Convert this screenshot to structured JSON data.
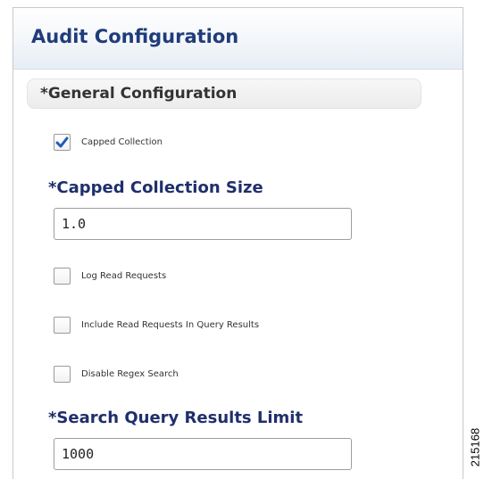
{
  "panel": {
    "title": "Audit Configuration"
  },
  "section": {
    "title": "*General Configuration"
  },
  "checkboxes": [
    {
      "label": "Capped Collection",
      "checked": true
    },
    {
      "label": "Log Read Requests",
      "checked": false
    },
    {
      "label": "Include Read Requests In Query Results",
      "checked": false
    },
    {
      "label": "Disable Regex Search",
      "checked": false
    }
  ],
  "capped_collection_size": {
    "label": "*Capped Collection Size",
    "value": "1.0"
  },
  "search_query_results_limit": {
    "label": "*Search Query Results Limit",
    "value": "1000"
  },
  "figure_id": "215168",
  "colors": {
    "title": "#1f3c7a",
    "field_label": "#1f2f6b",
    "check_mark": "#1e5bb8"
  },
  "icons": {
    "checked": "check-icon"
  }
}
